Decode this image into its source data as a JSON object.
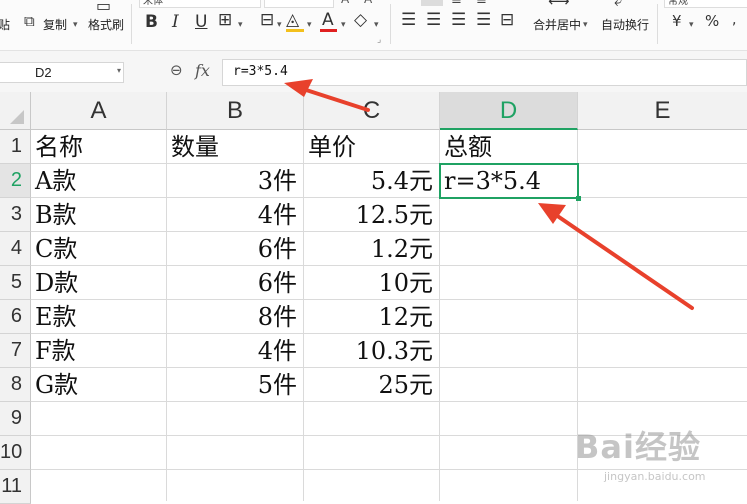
{
  "toolbar": {
    "paste_label": "粘贴",
    "copy_label": "复制",
    "format_painter_label": "格式刷",
    "font_name": "宋体",
    "bold_label": "B",
    "italic_label": "I",
    "underline_label": "U",
    "font_color_label": "A",
    "merge_center_label": "合并居中",
    "wrap_text_label": "自动换行",
    "number_format": "常规",
    "currency_symbol": "¥",
    "percent_symbol": "%"
  },
  "formula_bar": {
    "name_box": "D2",
    "fx_label": "fx",
    "formula": "r=3*5.4"
  },
  "columns": [
    "A",
    "B",
    "C",
    "D",
    "E"
  ],
  "rows": [
    {
      "num": "1",
      "a": "名称",
      "b": "数量",
      "c": "单价",
      "d": "总额"
    },
    {
      "num": "2",
      "a": "A款",
      "b": "3件",
      "c": "5.4元",
      "d": "r=3*5.4"
    },
    {
      "num": "3",
      "a": "B款",
      "b": "4件",
      "c": "12.5元",
      "d": ""
    },
    {
      "num": "4",
      "a": "C款",
      "b": "6件",
      "c": "1.2元",
      "d": ""
    },
    {
      "num": "5",
      "a": "D款",
      "b": "6件",
      "c": "10元",
      "d": ""
    },
    {
      "num": "6",
      "a": "E款",
      "b": "8件",
      "c": "12元",
      "d": ""
    },
    {
      "num": "7",
      "a": "F款",
      "b": "4件",
      "c": "10.3元",
      "d": ""
    },
    {
      "num": "8",
      "a": "G款",
      "b": "5件",
      "c": "25元",
      "d": ""
    },
    {
      "num": "9",
      "a": "",
      "b": "",
      "c": "",
      "d": ""
    },
    {
      "num": "10",
      "a": "",
      "b": "",
      "c": "",
      "d": ""
    },
    {
      "num": "11",
      "a": "",
      "b": "",
      "c": "",
      "d": ""
    }
  ],
  "selected_cell": "D2",
  "colors": {
    "accent": "#1fa263",
    "arrow": "#e8412c"
  },
  "watermark": {
    "brand": "Bai经验",
    "url": "jingyan.baidu.com"
  }
}
